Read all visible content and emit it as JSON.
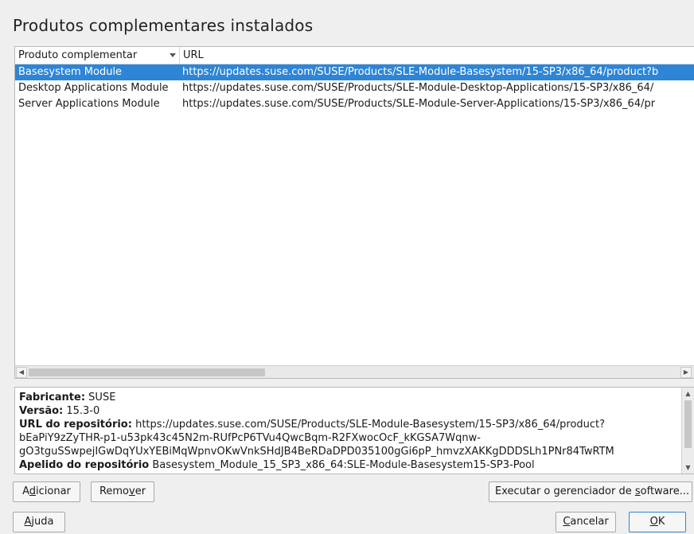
{
  "dialog": {
    "title": "Produtos complementares instalados"
  },
  "table": {
    "columns": [
      "Produto complementar",
      "URL"
    ],
    "rows": [
      {
        "product": "Basesystem Module",
        "url": "https://updates.suse.com/SUSE/Products/SLE-Module-Basesystem/15-SP3/x86_64/product?b",
        "selected": true
      },
      {
        "product": "Desktop Applications Module",
        "url": "https://updates.suse.com/SUSE/Products/SLE-Module-Desktop-Applications/15-SP3/x86_64/",
        "selected": false
      },
      {
        "product": "Server Applications Module",
        "url": "https://updates.suse.com/SUSE/Products/SLE-Module-Server-Applications/15-SP3/x86_64/pr",
        "selected": false
      }
    ]
  },
  "details": {
    "vendor_label": "Fabricante:",
    "vendor_value": "SUSE",
    "version_label": "Versão:",
    "version_value": "15.3-0",
    "repo_url_label": "URL do repositório:",
    "repo_url_value": "https://updates.suse.com/SUSE/Products/SLE-Module-Basesystem/15-SP3/x86_64/product?",
    "repo_url_line2": "bEaPiY9zZyTHR-p1-u53pk43c45N2m-RUfPcP6TVu4QwcBqm-R2FXwocOcF_kKGSA7Wqnw-",
    "repo_url_line3": "gO3tguSSwpejIGwDqYUxYEBiMqWpnvOKwVnkSHdJB4BeRDaDPD035100gGi6pP_hmvzXAKKgDDDSLh1PNr84TwRTM",
    "repo_alias_label": "Apelido do repositório",
    "repo_alias_value": "Basesystem_Module_15_SP3_x86_64:SLE-Module-Basesystem15-SP3-Pool"
  },
  "buttons": {
    "add": {
      "pre": "A",
      "key": "d",
      "post": "icionar"
    },
    "remove": {
      "pre": "Remo",
      "key": "v",
      "post": "er"
    },
    "run": {
      "pre": "Executar o gerenciador de ",
      "key": "s",
      "post": "oftware..."
    },
    "help": {
      "pre": "",
      "key": "A",
      "post": "juda"
    },
    "cancel": {
      "pre": "",
      "key": "C",
      "post": "ancelar"
    },
    "ok": {
      "pre": "",
      "key": "O",
      "post": "K"
    }
  },
  "icons": {
    "sort": "chevron-down-icon",
    "scroll_left": "arrow-left-icon",
    "scroll_right": "arrow-right-icon",
    "scroll_up": "arrow-up-icon",
    "scroll_down": "arrow-down-icon"
  }
}
